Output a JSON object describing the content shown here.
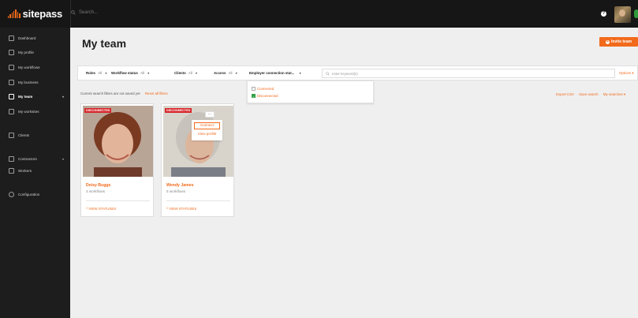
{
  "app": {
    "brand": "sitepass",
    "search_placeholder": "Search..."
  },
  "sidebar": {
    "items": [
      {
        "label": "Dashboard",
        "icon": "home-icon"
      },
      {
        "label": "My profile",
        "icon": "id-card-icon"
      },
      {
        "label": "My workflows",
        "icon": "workflow-icon"
      },
      {
        "label": "My business",
        "icon": "building-icon"
      },
      {
        "label": "My team",
        "icon": "team-icon",
        "active": true,
        "caret": "▾"
      },
      {
        "label": "My worksites",
        "icon": "worksite-icon"
      },
      {
        "label": "Clients",
        "icon": "clients-icon"
      },
      {
        "label": "Contractors",
        "icon": "contractors-icon",
        "caret": "▾"
      },
      {
        "label": "Workers",
        "icon": "worker-icon"
      },
      {
        "label": "Configuration",
        "icon": "gear-icon"
      }
    ]
  },
  "page": {
    "title": "My team",
    "invite_label": "Invite team"
  },
  "filters": {
    "roles": {
      "label": "Roles",
      "value": "All"
    },
    "workflow": {
      "label": "Workflow status",
      "value": "All"
    },
    "clients": {
      "label": "Clients",
      "value": "All"
    },
    "access": {
      "label": "Access",
      "value": "All"
    },
    "employer": {
      "label": "Employer connection stat..."
    },
    "keyword_placeholder": "enter keyword(s)",
    "options_label": "Options"
  },
  "dropdown": {
    "options": [
      {
        "label": "Connected",
        "checked": false
      },
      {
        "label": "Disconnected",
        "checked": true
      }
    ]
  },
  "notice": {
    "text": "Current search filters are not saved yet",
    "reset": "Reset all filters"
  },
  "actions": {
    "export": "Export CSV",
    "save": "Save search",
    "my_searches": "My searches ▾"
  },
  "cards": [
    {
      "badge": "DISCONNECTED",
      "name": "Deisy Buggs",
      "workflows": "3 workflows",
      "view_statuses": "^ VIEW STATUSES"
    },
    {
      "badge": "DISCONNECTED",
      "name": "Wendy James",
      "workflows": "5 workflows",
      "view_statuses": "^ VIEW STATUSES"
    }
  ],
  "card_menu": {
    "dots": "...",
    "connect": "Connect",
    "view_profile": "View profile"
  },
  "colors": {
    "accent": "#f26a1b",
    "danger": "#d7262b",
    "sidebar": "#1d1d1d",
    "topbar": "#161616",
    "check": "#2f9e44"
  }
}
